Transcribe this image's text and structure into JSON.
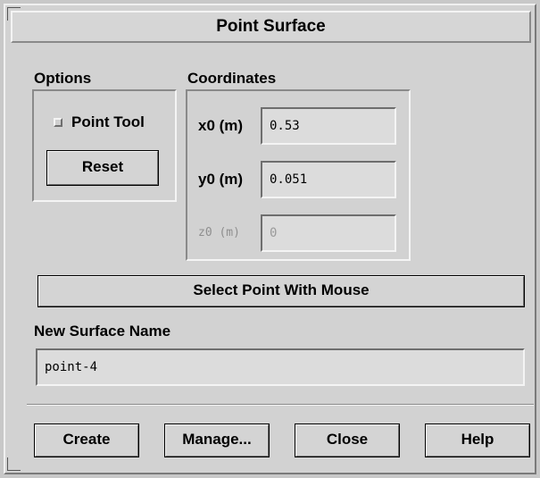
{
  "dialog": {
    "title": "Point Surface"
  },
  "options": {
    "heading": "Options",
    "point_tool_label": "Point Tool",
    "point_tool_checked": false,
    "reset_label": "Reset"
  },
  "coordinates": {
    "heading": "Coordinates",
    "x0": {
      "label": "x0 (m)",
      "value": "0.53"
    },
    "y0": {
      "label": "y0 (m)",
      "value": "0.051"
    },
    "z0": {
      "label": "z0 (m)",
      "value": "0",
      "enabled": false
    }
  },
  "select_point_label": "Select Point With Mouse",
  "surface_name": {
    "label": "New Surface Name",
    "value": "point-4"
  },
  "actions": {
    "create": "Create",
    "manage": "Manage...",
    "close": "Close",
    "help": "Help"
  }
}
